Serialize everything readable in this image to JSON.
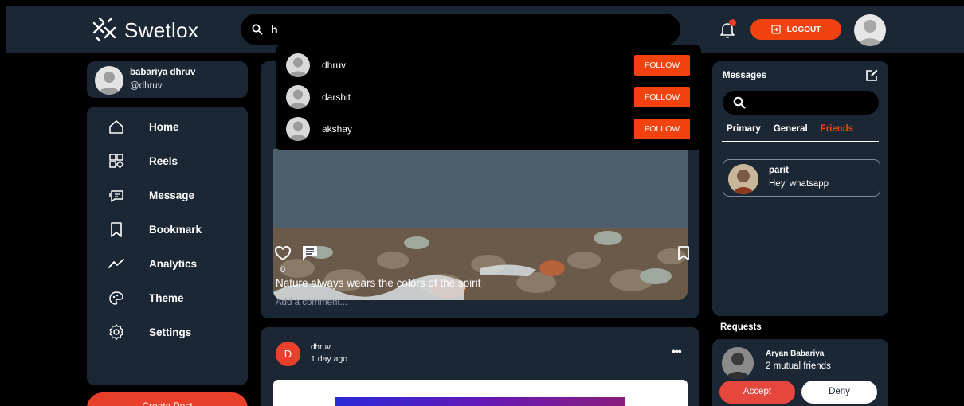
{
  "app": {
    "name": "Swetlox",
    "logout_label": "LOGOUT"
  },
  "search": {
    "value": "h",
    "results": [
      {
        "name": "dhruv",
        "action": "FOLLOW"
      },
      {
        "name": "darshit",
        "action": "FOLLOW"
      },
      {
        "name": "akshay",
        "action": "FOLLOW"
      }
    ]
  },
  "user": {
    "name": "babariya dhruv",
    "handle": "@dhruv"
  },
  "nav": [
    {
      "label": "Home",
      "icon": "home-icon"
    },
    {
      "label": "Reels",
      "icon": "reels-icon"
    },
    {
      "label": "Message",
      "icon": "message-icon"
    },
    {
      "label": "Bookmark",
      "icon": "bookmark-icon"
    },
    {
      "label": "Analytics",
      "icon": "analytics-icon"
    },
    {
      "label": "Theme",
      "icon": "theme-icon"
    },
    {
      "label": "Settings",
      "icon": "settings-icon"
    }
  ],
  "create_post": "Create Post",
  "post1": {
    "likes": "0",
    "caption": "Nature always wears the colors of the spirit",
    "comment_placeholder": "Add a comment..."
  },
  "post2": {
    "initial": "D",
    "author": "dhruv",
    "time": "1 day ago",
    "more": "•••"
  },
  "messages": {
    "title": "Messages",
    "tabs": [
      "Primary",
      "General",
      "Friends"
    ],
    "active_tab": "Friends",
    "chats": [
      {
        "name": "parit",
        "text": "Hey' whatsapp"
      }
    ]
  },
  "requests": {
    "title": "Requests",
    "items": [
      {
        "name": "Aryan Babariya",
        "mutual": "2 mutual friends",
        "accept": "Accept",
        "deny": "Deny"
      }
    ]
  },
  "colors": {
    "accent": "#f2420f",
    "panel": "#1c2735",
    "background": "#000000"
  }
}
